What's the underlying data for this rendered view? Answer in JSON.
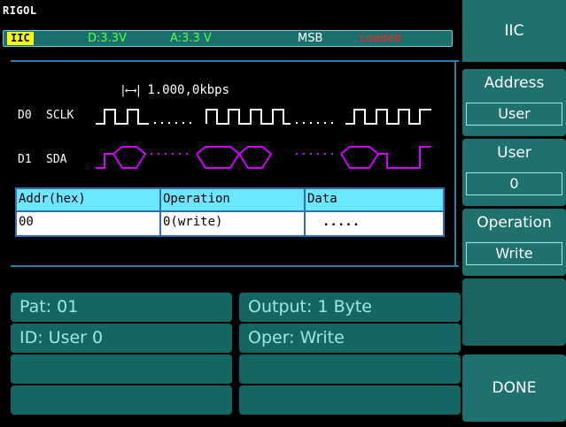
{
  "brand": "RIGOL",
  "status": {
    "mode": "IIC",
    "digital_voltage": "D:3.3V",
    "analog_voltage": "A:3.3 V",
    "bit_order": "MSB",
    "state": "Loaded"
  },
  "rate": "1.000,0kbps",
  "channels": [
    {
      "id": "D0",
      "name": "SCLK"
    },
    {
      "id": "D1",
      "name": "SDA"
    }
  ],
  "table": {
    "headers": [
      "Addr(hex)",
      "Operation",
      "Data"
    ],
    "row": [
      "00",
      "0(write)",
      "....."
    ]
  },
  "info_panel": {
    "pattern": "Pat:  01",
    "output": "Output: 1  Byte",
    "id": "ID:  User 0",
    "oper": "Oper:  Write"
  },
  "menu": {
    "title": "IIC",
    "address": {
      "label": "Address",
      "value": "User"
    },
    "user": {
      "label": "User",
      "value": "0"
    },
    "operation": {
      "label": "Operation",
      "value": "Write"
    },
    "done": "DONE"
  },
  "colors": {
    "accent": "#1f716d",
    "status_bar": "#1b6f6c",
    "mode_badge": "#ffff00",
    "voltage_text": "#5cff3a",
    "loaded_text": "#ff2020",
    "sclk_trace": "#ffffff",
    "sda_trace": "#d400ff",
    "table_header": "#6be8ff"
  }
}
